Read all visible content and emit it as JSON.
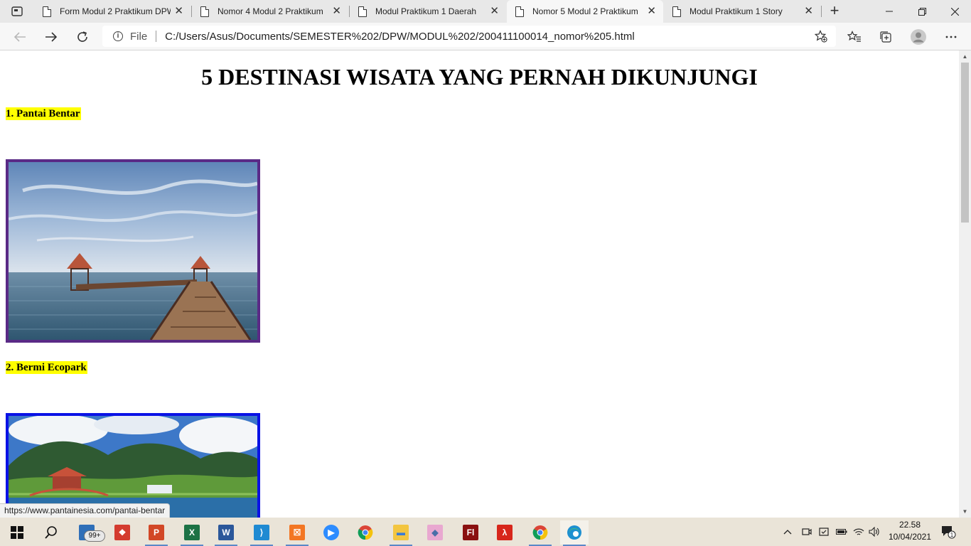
{
  "browser": {
    "tabs": [
      {
        "title": "Form Modul 2 Praktikum DPW",
        "active": false
      },
      {
        "title": "Nomor 4 Modul 2 Praktikum",
        "active": false
      },
      {
        "title": "Modul Praktikum 1 Daerah",
        "active": false
      },
      {
        "title": "Nomor 5 Modul 2 Praktikum",
        "active": true
      },
      {
        "title": "Modul Praktikum 1 Story",
        "active": false
      }
    ],
    "tab_close": "✕",
    "new_tab": "+",
    "address": {
      "scheme_label": "File",
      "url": "C:/Users/Asus/Documents/SEMESTER%202/DPW/MODUL%202/200411100014_nomor%205.html"
    },
    "status_url": "https://www.pantainesia.com/pantai-bentar"
  },
  "page": {
    "title": "5 DESTINASI WISATA YANG PERNAH DIKUNJUNGI",
    "destinations": [
      {
        "label": "1. Pantai Bentar",
        "border_color": "#5a2a86"
      },
      {
        "label": "2. Bermi Ecopark",
        "border_color": "#0a12e6"
      }
    ]
  },
  "taskbar": {
    "apps": [
      "file-explorer-store",
      "gift-app",
      "powerpoint",
      "excel",
      "word",
      "vscode",
      "xampp",
      "zoom",
      "chrome",
      "file-explorer",
      "maps-app",
      "flash",
      "acrobat",
      "chrome-alt",
      "edge"
    ],
    "badge": "99+",
    "clock": {
      "time": "22.58",
      "date": "10/04/2021"
    },
    "notification_count": "1"
  }
}
